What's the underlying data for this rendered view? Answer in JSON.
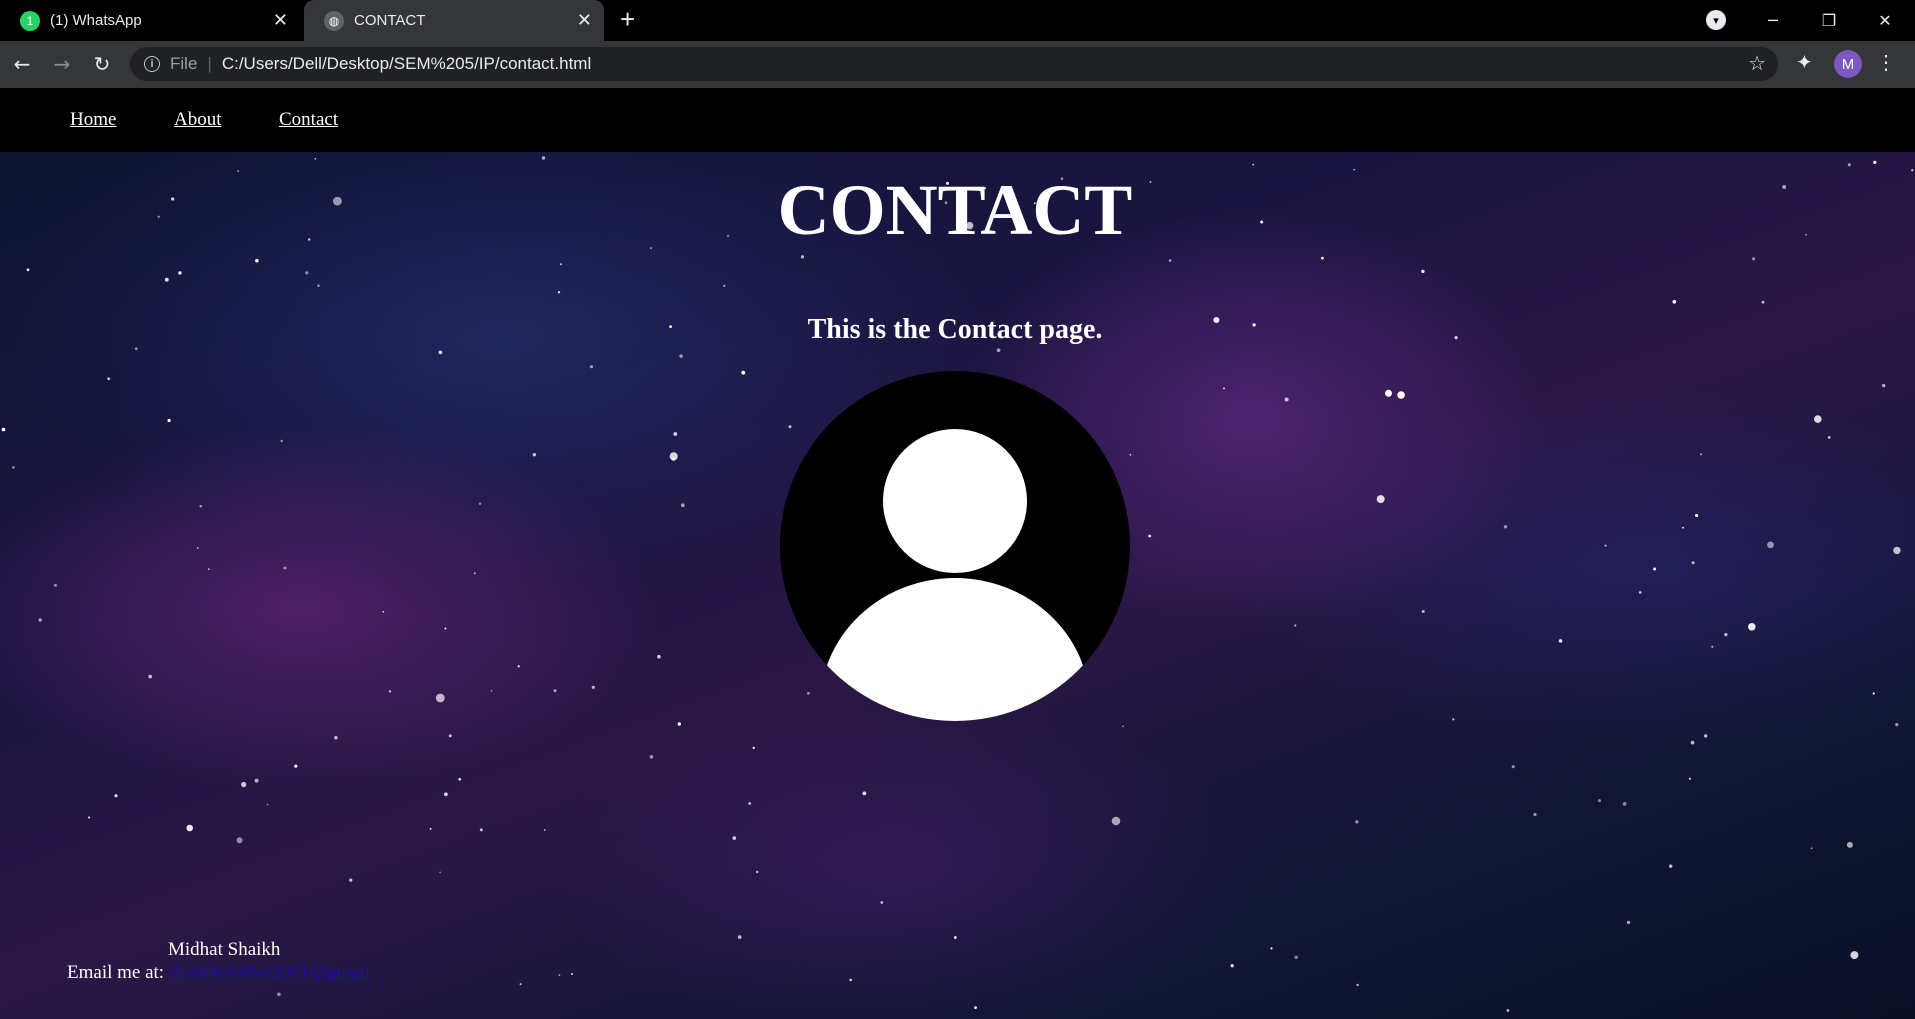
{
  "browser": {
    "tabs": [
      {
        "title": "(1) WhatsApp",
        "badge": "1",
        "icon": "whatsapp-icon",
        "active": false
      },
      {
        "title": "CONTACT",
        "icon": "globe-icon",
        "active": true
      }
    ],
    "new_tab_glyph": "+",
    "address": {
      "scheme": "File",
      "url": "C:/Users/Dell/Desktop/SEM%205/IP/contact.html"
    },
    "profile_initial": "M"
  },
  "nav": {
    "items": [
      {
        "label": "Home "
      },
      {
        "label": "About "
      },
      {
        "label": "Contact"
      }
    ]
  },
  "page": {
    "title": "CONTACT",
    "subtitle": "This is the Contact page.",
    "avatar_icon": "user-silhouette-icon"
  },
  "footer": {
    "name": "Midhat Shaikh",
    "email_label": "Email me at:",
    "email_link": "shaikhmidhat2001@gmail"
  },
  "colors": {
    "link": "#1a0dab",
    "nav_bg": "#000000",
    "text": "#ffffff"
  }
}
